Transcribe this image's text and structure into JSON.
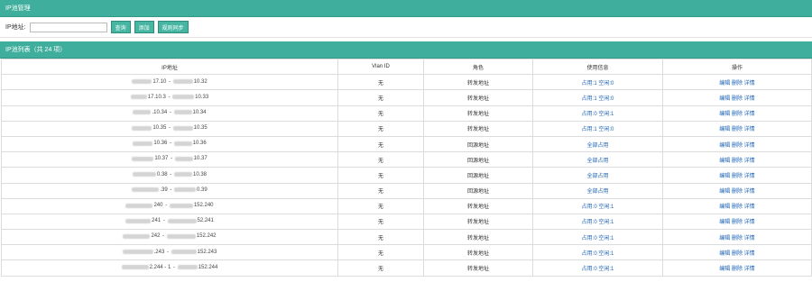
{
  "panel_title": "IP池管理",
  "search": {
    "label": "IP地址:",
    "value": "",
    "placeholder": ""
  },
  "buttons": {
    "query": "查询",
    "add": "添加",
    "sync": "规则同步"
  },
  "list_title": "IP池列表（共 24 项）",
  "columns": [
    "IP地址",
    "Vlan ID",
    "角色",
    "使用信息",
    "操作"
  ],
  "rows": [
    {
      "ip_a": "17.10",
      "ip_b": "10.32",
      "vlan": "无",
      "role": "转发地址",
      "info": "占用:1 空闲:0"
    },
    {
      "ip_a": "17.10.3",
      "ip_b": "10.33",
      "vlan": "无",
      "role": "转发地址",
      "info": "占用:1 空闲:0"
    },
    {
      "ip_a": ".10.34",
      "ip_b": "10.34",
      "vlan": "无",
      "role": "转发地址",
      "info": "占用:0 空闲:1"
    },
    {
      "ip_a": "10.35",
      "ip_b": "10.35",
      "vlan": "无",
      "role": "转发地址",
      "info": "占用:1 空闲:0"
    },
    {
      "ip_a": "10.36",
      "ip_b": "10.36",
      "vlan": "无",
      "role": "回源地址",
      "info": "全部占用"
    },
    {
      "ip_a": "10.37",
      "ip_b": "10.37",
      "vlan": "无",
      "role": "回源地址",
      "info": "全部占用"
    },
    {
      "ip_a": "0.38",
      "ip_b": "10.38",
      "vlan": "无",
      "role": "回源地址",
      "info": "全部占用"
    },
    {
      "ip_a": ".39",
      "ip_b": "0.39",
      "vlan": "无",
      "role": "回源地址",
      "info": "全部占用"
    },
    {
      "ip_a": "240",
      "ip_b": "152.240",
      "vlan": "无",
      "role": "转发地址",
      "info": "占用:0 空闲:1"
    },
    {
      "ip_a": "241",
      "ip_b": "52.241",
      "vlan": "无",
      "role": "转发地址",
      "info": "占用:0 空闲:1"
    },
    {
      "ip_a": "242",
      "ip_b": "152.242",
      "vlan": "无",
      "role": "转发地址",
      "info": "占用:0 空闲:1"
    },
    {
      "ip_a": ".243",
      "ip_b": "152.243",
      "vlan": "无",
      "role": "转发地址",
      "info": "占用:0 空闲:1"
    },
    {
      "ip_a": "2.244 - 1",
      "ip_b": "152.244",
      "vlan": "无",
      "role": "转发地址",
      "info": "占用:0 空闲:1"
    }
  ],
  "actions": {
    "edit": "编辑",
    "delete": "删除",
    "detail": "详情"
  }
}
